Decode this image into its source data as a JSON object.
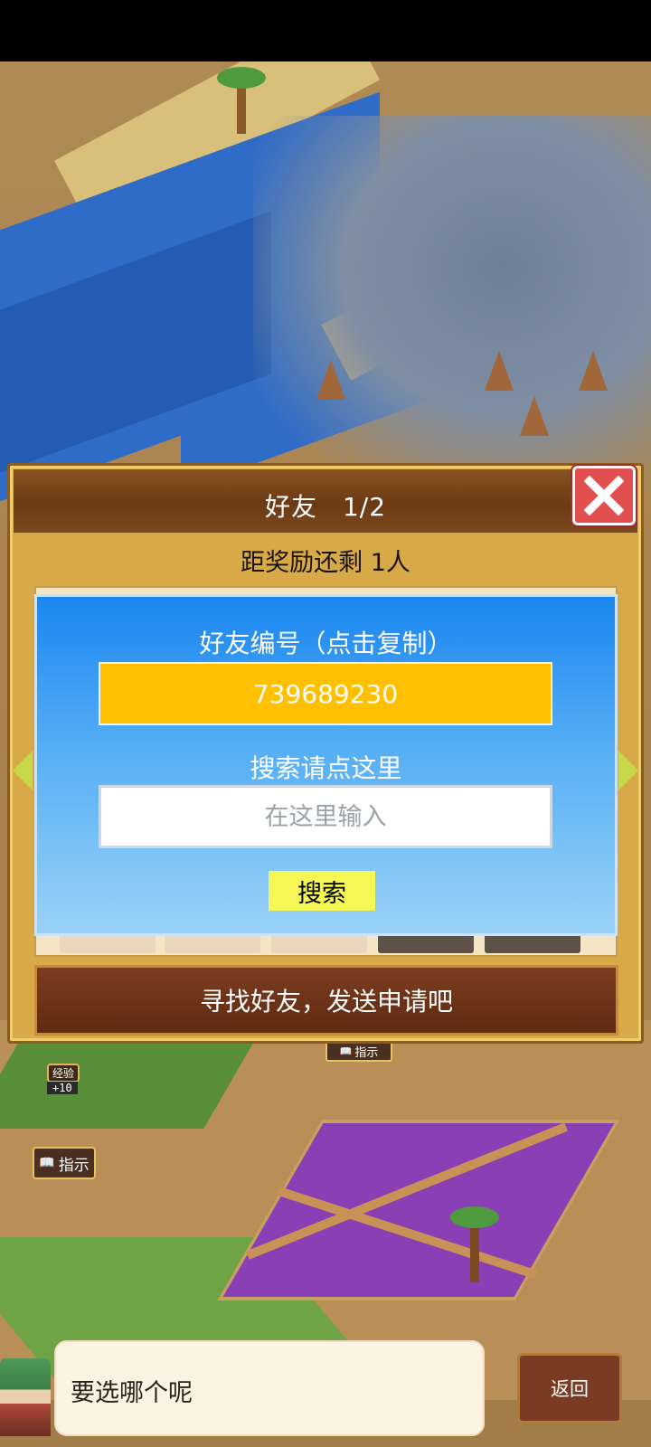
{
  "dialog": {
    "title": "好友",
    "page_indicator": "1/2",
    "reward_text": "距奖励还剩 1人",
    "find_friends_label": "寻找好友，发送申请吧"
  },
  "popup": {
    "friend_id_label": "好友编号（点击复制）",
    "friend_id": "739689230",
    "search_label": "搜索请点这里",
    "search_placeholder": "在这里输入",
    "search_button": "搜索"
  },
  "map": {
    "guide_label": "指示",
    "guide_label_2": "指示",
    "exp_badge": "经验",
    "exp_value": "+10"
  },
  "bottom": {
    "message": "要选哪个呢",
    "back_label": "返回"
  },
  "colors": {
    "popup_blue": "#1a86f0",
    "id_box": "#ffc000",
    "search_button": "#f4f754",
    "close_red": "#e24f4f",
    "dialog_gold": "#d8aa47"
  }
}
